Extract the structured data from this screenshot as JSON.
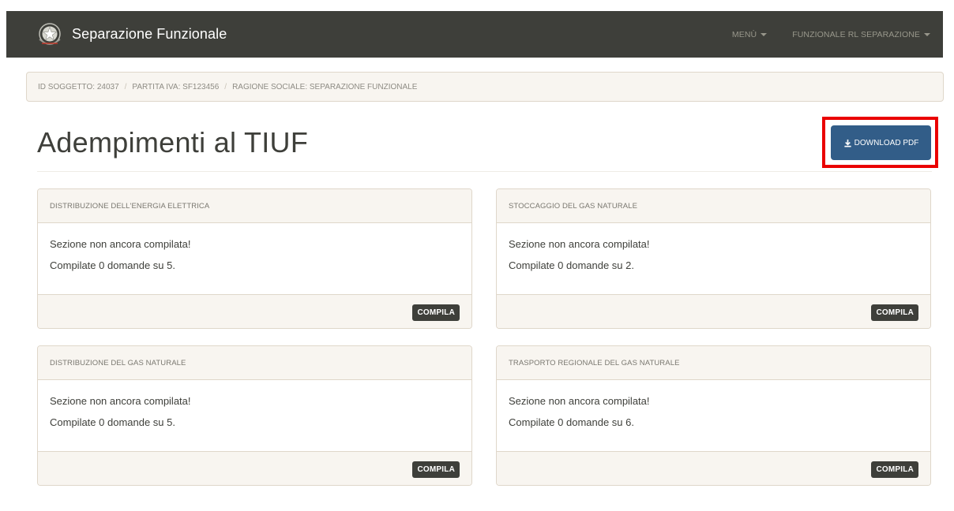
{
  "navbar": {
    "brand_title": "Separazione Funzionale",
    "menu_label": "Menù",
    "user_label": "Funzionale RL Separazione"
  },
  "breadcrumb": {
    "items": [
      "ID SOGGETTO: 24037",
      "PARTITA IVA: SF123456",
      "RAGIONE SOCIALE: SEPARAZIONE FUNZIONALE"
    ],
    "separator": "/"
  },
  "page": {
    "title": "Adempimenti al TIUF",
    "download_label": "Download PDF"
  },
  "sections": [
    {
      "title": "Distribuzione dell'energia elettrica",
      "status": "Sezione non ancora compilata!",
      "progress": "Compilate 0 domande su 5.",
      "action_label": "Compila"
    },
    {
      "title": "Stoccaggio del gas naturale",
      "status": "Sezione non ancora compilata!",
      "progress": "Compilate 0 domande su 2.",
      "action_label": "Compila"
    },
    {
      "title": "Distribuzione del gas naturale",
      "status": "Sezione non ancora compilata!",
      "progress": "Compilate 0 domande su 5.",
      "action_label": "Compila"
    },
    {
      "title": "Trasporto regionale del gas naturale",
      "status": "Sezione non ancora compilata!",
      "progress": "Compilate 0 domande su 6.",
      "action_label": "Compila"
    }
  ],
  "icons": {
    "brand": "emblem-icon",
    "download": "download-icon",
    "dropdown": "caret-down-icon"
  },
  "colors": {
    "navbar_bg": "#3e3f3a",
    "primary_button": "#325d88",
    "highlight_border": "#ea0000",
    "panel_bg": "#f8f5f0",
    "dark_button": "#3e3f3a"
  }
}
